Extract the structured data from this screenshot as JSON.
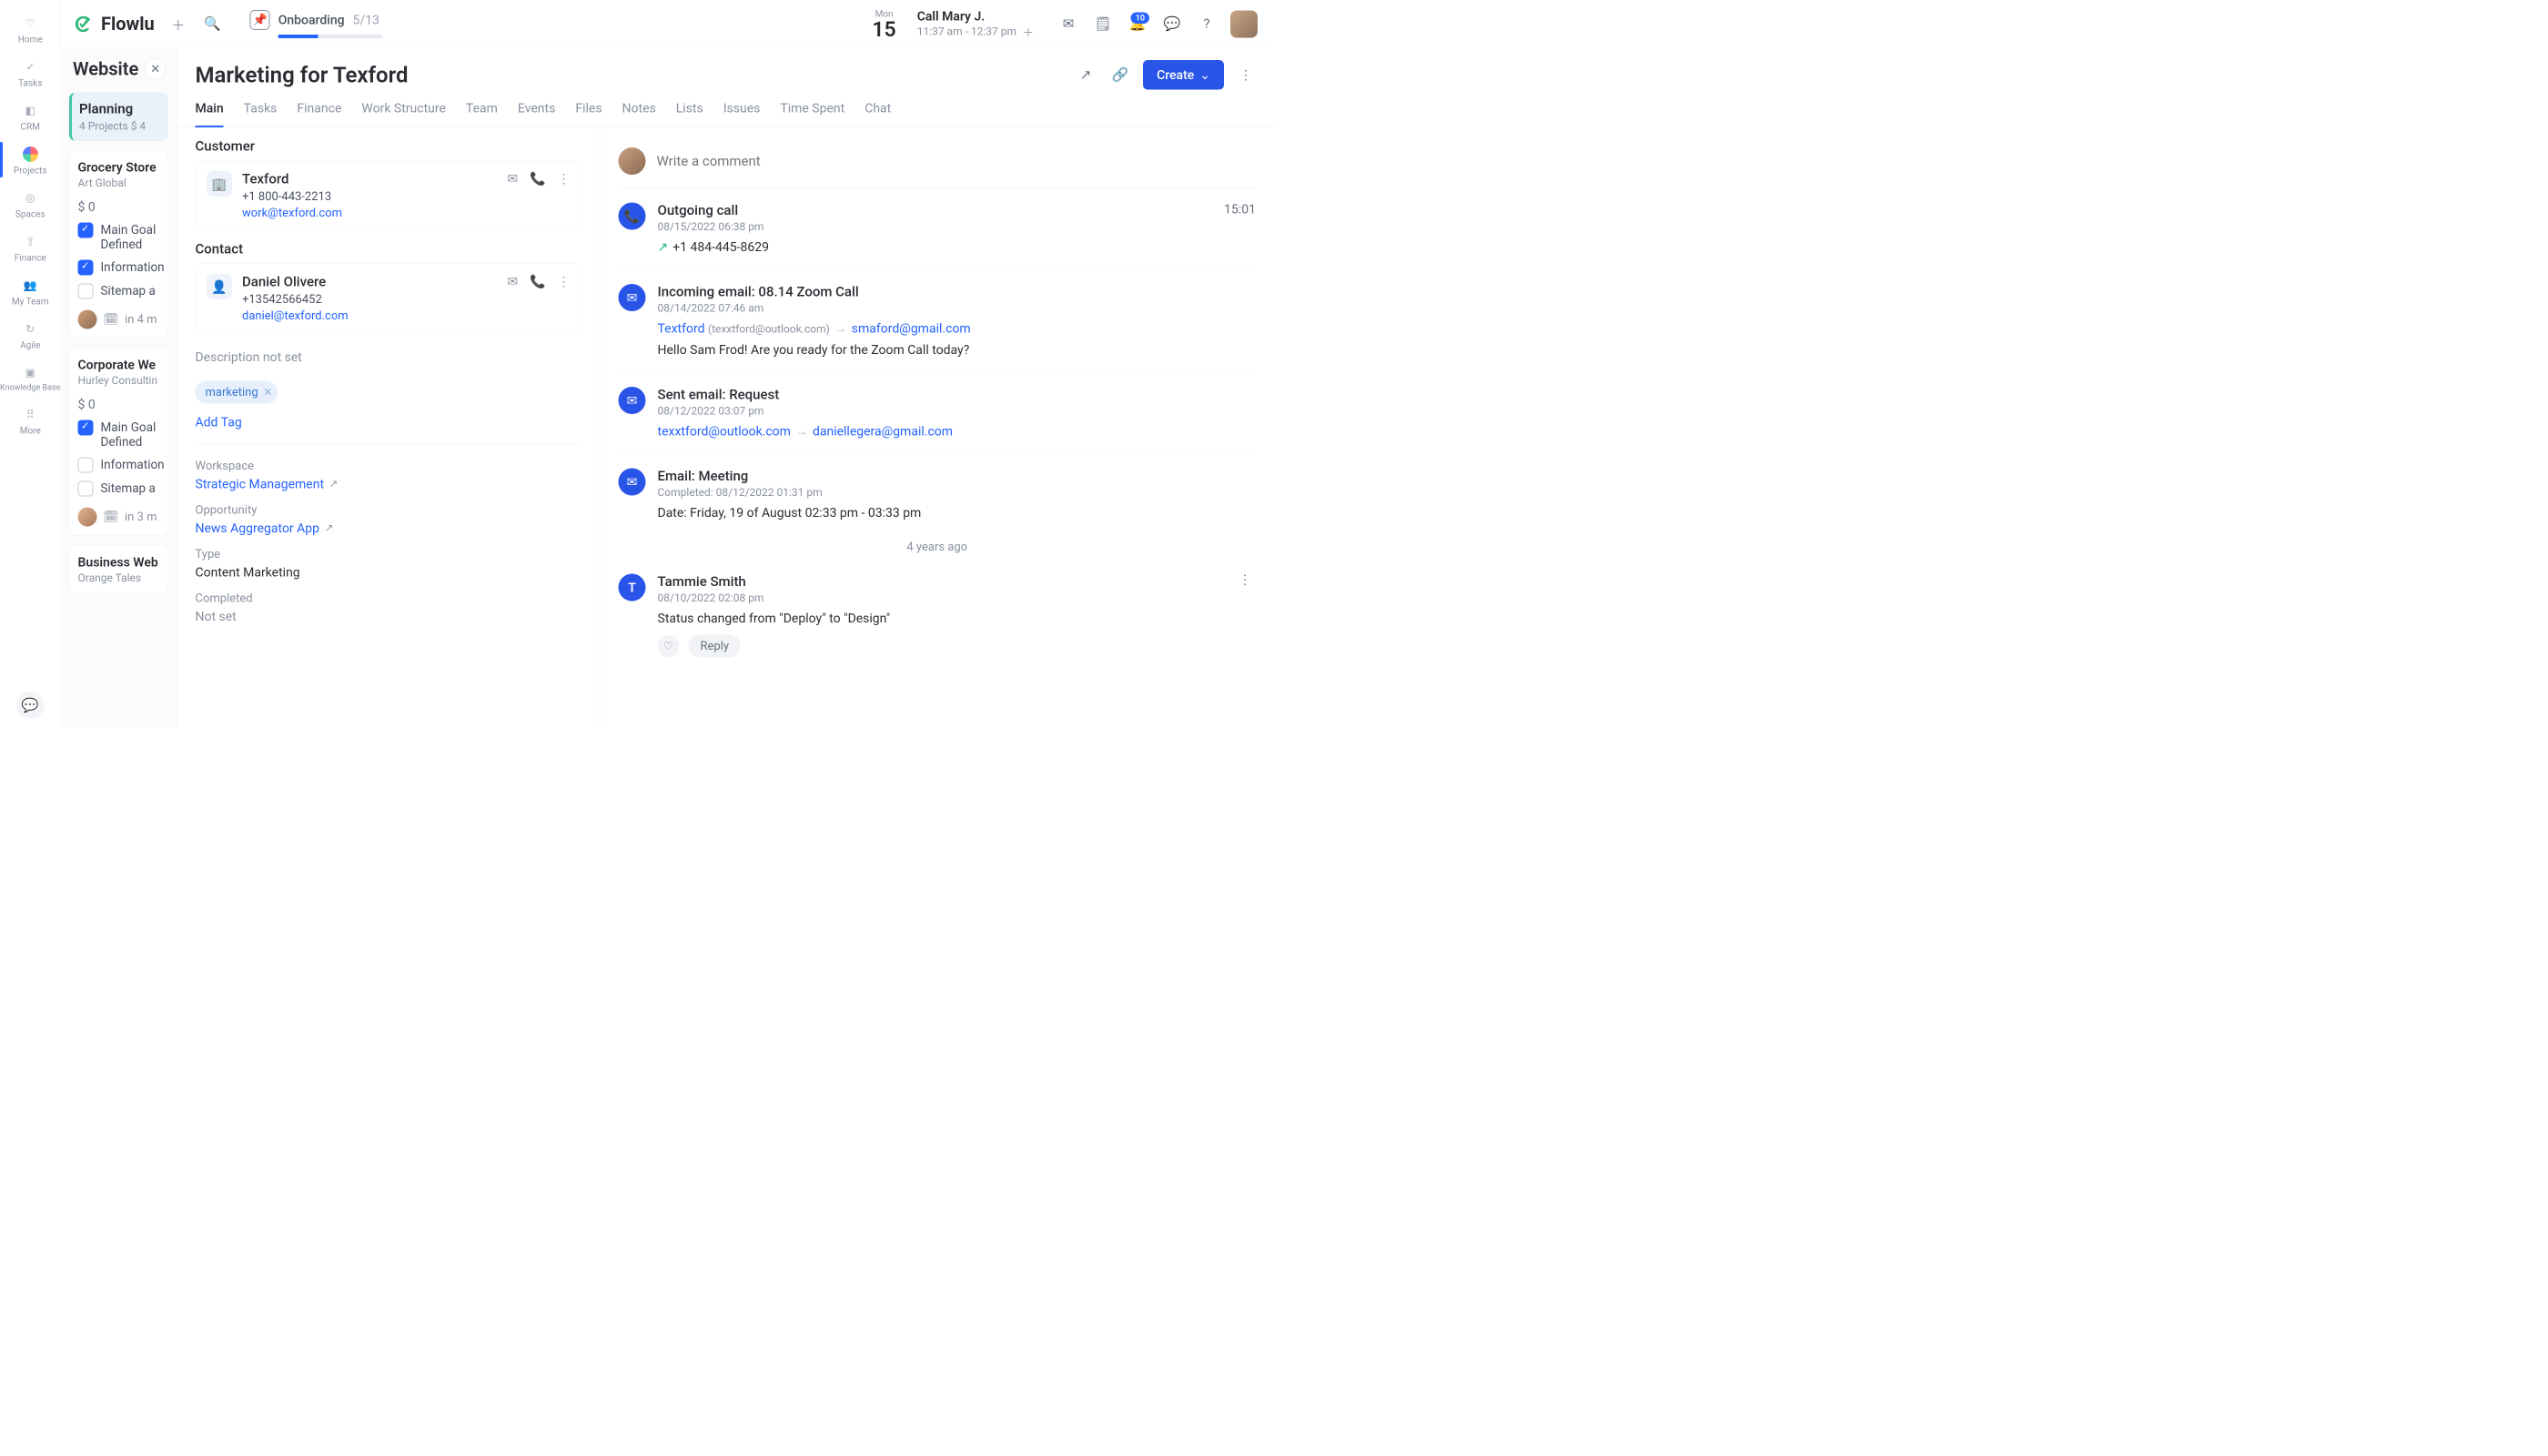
{
  "brand": "Flowlu",
  "header": {
    "onboarding_label": "Onboarding",
    "onboarding_count": "5/13",
    "date_dow": "Mon",
    "date_dom": "15",
    "call_title": "Call Mary J.",
    "call_time": "11:37 am - 12:37 pm",
    "bell_badge": "10"
  },
  "rail": {
    "items": [
      {
        "label": "Home",
        "icon": "♡"
      },
      {
        "label": "Tasks",
        "icon": "✓"
      },
      {
        "label": "CRM",
        "icon": "◧"
      },
      {
        "label": "Projects",
        "icon": "●",
        "active": true
      },
      {
        "label": "Spaces",
        "icon": "◎"
      },
      {
        "label": "Finance",
        "icon": "⇪"
      },
      {
        "label": "My Team",
        "icon": "👥"
      },
      {
        "label": "Agile",
        "icon": "↻"
      },
      {
        "label": "Knowledge Base",
        "icon": "▣"
      },
      {
        "label": "More",
        "icon": "⋯"
      }
    ]
  },
  "colA": {
    "title": "Website",
    "stage": {
      "name": "Planning",
      "meta": "4 Projects   $ 4"
    },
    "cards": [
      {
        "title": "Grocery Store",
        "sub": "Art Global",
        "amount": "$ 0",
        "tasks": [
          {
            "done": true,
            "text": "Main Goal Defined"
          },
          {
            "done": true,
            "text": "Information"
          },
          {
            "done": false,
            "text": "Sitemap a"
          }
        ],
        "due": "in 4 m"
      },
      {
        "title": "Corporate We",
        "sub": "Hurley Consultin",
        "amount": "$ 0",
        "tasks": [
          {
            "done": true,
            "text": "Main Goal Defined"
          },
          {
            "done": false,
            "text": "Information"
          },
          {
            "done": false,
            "text": "Sitemap a"
          }
        ],
        "due": "in 3 m"
      },
      {
        "title": "Business Web",
        "sub": "Orange Tales"
      }
    ]
  },
  "project": {
    "title": "Marketing for Texford",
    "create_label": "Create",
    "tabs": [
      "Main",
      "Tasks",
      "Finance",
      "Work Structure",
      "Team",
      "Events",
      "Files",
      "Notes",
      "Lists",
      "Issues",
      "Time Spent",
      "Chat"
    ],
    "customer_h": "Customer",
    "customer": {
      "name": "Texford",
      "phone": "+1 800-443-2213",
      "email": "work@texford.com"
    },
    "contact_h": "Contact",
    "contact": {
      "name": "Daniel Olivere",
      "phone": "+13542566452",
      "email": "daniel@texford.com"
    },
    "desc_empty": "Description not set",
    "tag": "marketing",
    "add_tag": "Add Tag",
    "workspace_k": "Workspace",
    "workspace_v": "Strategic Management",
    "opp_k": "Opportunity",
    "opp_v": "News Aggregator App",
    "type_k": "Type",
    "type_v": "Content Marketing",
    "completed_k": "Completed",
    "completed_v": "Not set"
  },
  "activity": {
    "comment_ph": "Write a comment",
    "items": [
      {
        "kind": "call",
        "title": "Outgoing call",
        "date": "08/15/2022 06:38 pm",
        "phone": "+1 484-445-8629",
        "dur": "15:01"
      },
      {
        "kind": "inmail",
        "title": "Incoming email: 08.14 Zoom Call",
        "date": "08/14/2022 07:46 am",
        "from": "Textford",
        "from_em": "(texxtford@outlook.com)",
        "to": "smaford@gmail.com",
        "body": "Hello Sam Frod! Are you ready for the Zoom Call today?"
      },
      {
        "kind": "outmail",
        "title": "Sent email: Request",
        "date": "08/12/2022 03:07 pm",
        "from": "texxtford@outlook.com",
        "to": "daniellegera@gmail.com"
      },
      {
        "kind": "event",
        "title": "Email: Meeting",
        "date": "Completed: 08/12/2022 01:31 pm",
        "body": "Date: Friday, 19 of August 02:33 pm - 03:33 pm"
      }
    ],
    "age": "4 years ago",
    "status": {
      "avatar": "T",
      "name": "Tammie Smith",
      "date": "08/10/2022 02:08 pm",
      "body": "Status changed from \"Deploy\" to \"Design\"",
      "reply": "Reply"
    }
  }
}
